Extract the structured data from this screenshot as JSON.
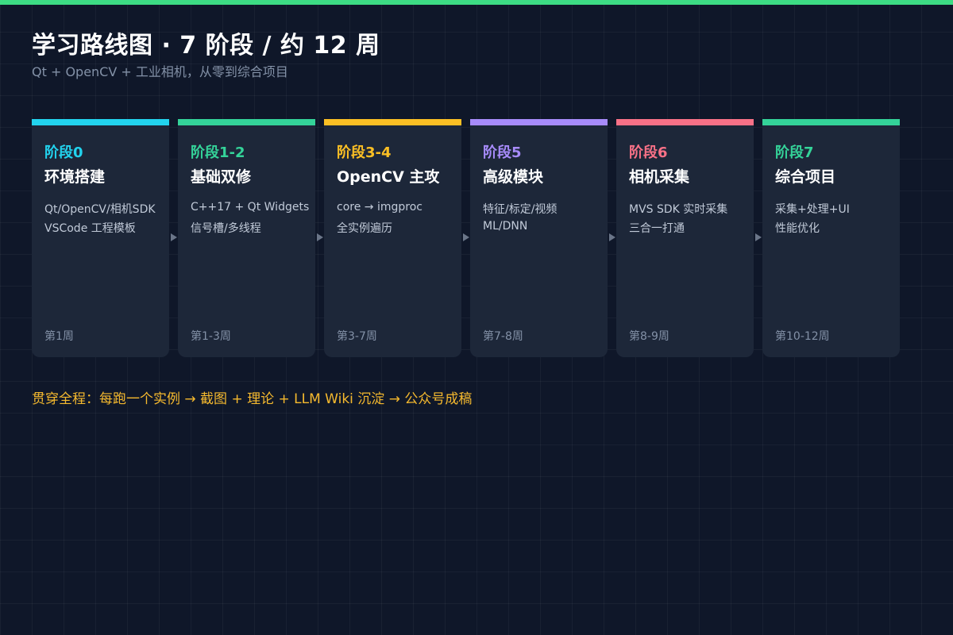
{
  "header": {
    "title": "学习路线图 · 7 阶段 / 约 12 周",
    "subtitle": "Qt + OpenCV + 工业相机，从零到综合项目"
  },
  "colors": {
    "background": "#0f1729",
    "card": "#1d2739",
    "top_bar": "#3ddc84",
    "footer_note": "#f5b92e"
  },
  "stages": [
    {
      "label": "阶段0",
      "title": "环境搭建",
      "lines": [
        "Qt/OpenCV/相机SDK",
        "VSCode 工程模板"
      ],
      "week": "第1周",
      "color": "#22d3ee"
    },
    {
      "label": "阶段1-2",
      "title": "基础双修",
      "lines": [
        "C++17 + Qt Widgets",
        "信号槽/多线程"
      ],
      "week": "第1-3周",
      "color": "#34d399"
    },
    {
      "label": "阶段3-4",
      "title": "OpenCV 主攻",
      "lines": [
        "core → imgproc",
        "全实例遍历"
      ],
      "week": "第3-7周",
      "color": "#fbbf24"
    },
    {
      "label": "阶段5",
      "title": "高级模块",
      "lines": [
        "特征/标定/视频",
        "ML/DNN"
      ],
      "week": "第7-8周",
      "color": "#a78bfa"
    },
    {
      "label": "阶段6",
      "title": "相机采集",
      "lines": [
        "MVS SDK 实时采集",
        "三合一打通"
      ],
      "week": "第8-9周",
      "color": "#f87187"
    },
    {
      "label": "阶段7",
      "title": "综合项目",
      "lines": [
        "采集+处理+UI",
        "性能优化"
      ],
      "week": "第10-12周",
      "color": "#34d399"
    }
  ],
  "footer": {
    "note": "贯穿全程：每跑一个实例 → 截图 + 理论 + LLM Wiki 沉淀 → 公众号成稿"
  }
}
